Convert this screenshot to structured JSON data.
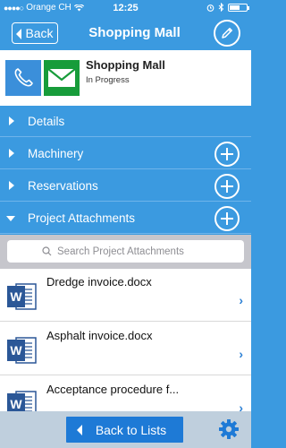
{
  "status_bar": {
    "carrier": "Orange CH",
    "time": "12:25",
    "battery_level": 0.6
  },
  "nav": {
    "back_label": "Back",
    "title": "Shopping Mall",
    "edit_icon": "pencil-icon"
  },
  "project": {
    "name": "Shopping Mall",
    "status": "In Progress",
    "phone_icon": "phone-icon",
    "mail_icon": "mail-icon"
  },
  "sections": [
    {
      "label": "Details",
      "expanded": false,
      "has_add": false
    },
    {
      "label": "Machinery",
      "expanded": false,
      "has_add": true
    },
    {
      "label": "Reservations",
      "expanded": false,
      "has_add": true
    },
    {
      "label": "Project Attachments",
      "expanded": true,
      "has_add": true
    }
  ],
  "search": {
    "placeholder": "Search Project Attachments"
  },
  "attachments": [
    {
      "name": "Dredge invoice.docx"
    },
    {
      "name": "Asphalt invoice.docx"
    },
    {
      "name": "Acceptance procedure f..."
    }
  ],
  "toolbar": {
    "back_label": "Back to Lists",
    "settings_icon": "gear-icon"
  },
  "colors": {
    "accent": "#3b9ae0",
    "phone_tile": "#3b8fda",
    "mail_tile": "#179c3a",
    "word_blue": "#2b5797",
    "toolbar_button": "#1e7ad6"
  }
}
